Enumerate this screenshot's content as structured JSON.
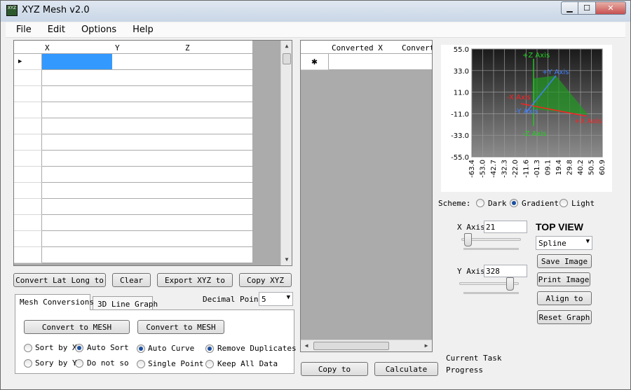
{
  "app": {
    "title": "XYZ Mesh v2.0",
    "icon_text": "XYZ",
    "icon": "app-logo-icon"
  },
  "window_controls": {
    "minimize": "minimize-icon",
    "maximize": "maximize-icon",
    "close": "close-icon"
  },
  "menu": [
    "File",
    "Edit",
    "Options",
    "Help"
  ],
  "input_grid": {
    "columns": [
      "X",
      "Y",
      "Z"
    ],
    "current_row_marker": "▶"
  },
  "output_grid": {
    "columns": [
      "Converted X",
      "Convert"
    ],
    "new_row_marker": "✱"
  },
  "buttons": {
    "convert_lat_long": "Convert Lat Long to",
    "clear": "Clear",
    "export_xyz": "Export XYZ to",
    "copy_xyz": "Copy XYZ",
    "copy_to": "Copy to",
    "calculate": "Calculate",
    "convert_mesh_1": "Convert to MESH",
    "convert_mesh_2": "Convert to MESH",
    "save_image": "Save Image",
    "print_image": "Print Image",
    "align_to": "Align to",
    "reset_graph": "Reset Graph"
  },
  "tabs": [
    "Mesh Conversions",
    "3D Line Graph"
  ],
  "decimal_point": {
    "label": "Decimal Point",
    "value": "5"
  },
  "sort_options": {
    "sort_by_x": "Sort by X",
    "sort_by_y": "Sory by Y",
    "auto_sort": "Auto Sort",
    "do_not_sort": "Do not sor"
  },
  "curve_options": {
    "auto_curve": "Auto Curve",
    "single_point": "Single Point"
  },
  "dup_options": {
    "remove": "Remove Duplicates",
    "keep": "Keep All Data"
  },
  "status": {
    "task": "Current Task",
    "progress": "Progress"
  },
  "scheme": {
    "label": "Scheme:",
    "dark": "Dark",
    "gradient": "Gradient",
    "light": "Light",
    "selected": "Gradient"
  },
  "x_axis": {
    "label": "X Axis",
    "value": "21",
    "level": 0.05
  },
  "y_axis": {
    "label": "Y Axis",
    "value": "328",
    "level": 0.91
  },
  "view": {
    "title": "TOP VIEW",
    "interpolation": "Spline"
  },
  "chart_data": {
    "type": "line",
    "y_ticks": [
      "55.0",
      "33.0",
      "11.0",
      "-11.0",
      "-33.0",
      "-55.0"
    ],
    "x_ticks": [
      "-63.4",
      "-53.0",
      "-42.7",
      "-32.3",
      "-22.0",
      "-11.6",
      "-01.3",
      "09.1",
      "19.4",
      "29.8",
      "40.2",
      "50.5",
      "60.9"
    ],
    "ylim": [
      -55.0,
      55.0
    ],
    "xlim": [
      -63.4,
      60.9
    ],
    "grid": true,
    "axis_labels": {
      "pos_z": "+Z Axis",
      "neg_z": "-Z Axis",
      "pos_y": "+Y Axis",
      "neg_y": "-Y Axis",
      "pos_x": "+X Axis",
      "neg_x": "-X Axis"
    },
    "colors": {
      "x_axis": "#ff2020",
      "y_axis": "#4080ff",
      "z_axis": "#20d020",
      "plane": "#1f9a1f"
    }
  }
}
